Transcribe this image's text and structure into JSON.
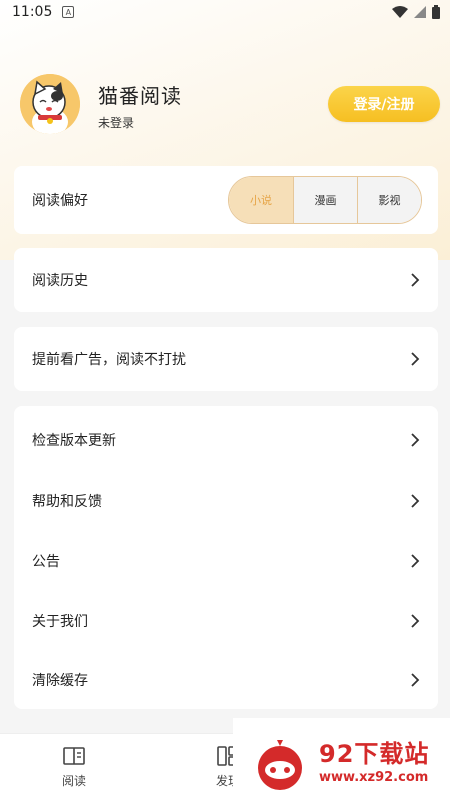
{
  "status_bar": {
    "time": "11:05",
    "notif_letter": "A"
  },
  "profile": {
    "app_name": "猫番阅读",
    "login_status": "未登录",
    "login_button": "登录/注册"
  },
  "preference": {
    "label": "阅读偏好",
    "options": [
      "小说",
      "漫画",
      "影视"
    ],
    "selected_index": 0
  },
  "menu": {
    "history": "阅读历史",
    "ad": "提前看广告，阅读不打扰",
    "check_update": "检查版本更新",
    "help": "帮助和反馈",
    "notice": "公告",
    "about": "关于我们",
    "clear_cache": "清除缓存"
  },
  "bottom_nav": {
    "read": "阅读",
    "discover": "发现"
  },
  "watermark": {
    "title": "92下载站",
    "url": "www.xz92.com"
  },
  "colors": {
    "accent": "#f6bf22",
    "seg_active_bg": "#f6dfb8",
    "seg_active_text": "#e6a548",
    "watermark": "#d42a2a"
  }
}
